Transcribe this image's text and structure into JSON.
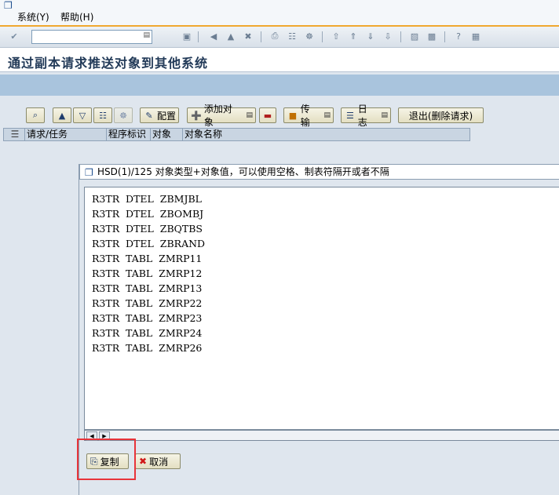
{
  "menu": {
    "system": "系统(Y)",
    "help": "帮助(H)"
  },
  "toolbar": {
    "command_field_value": "",
    "icons": [
      "enter-icon",
      "save-icon",
      "back-icon",
      "exit-icon",
      "cancel-icon",
      "print-icon",
      "find-icon",
      "find-next-icon",
      "first-page-icon",
      "previous-page-icon",
      "next-page-icon",
      "last-page-icon",
      "create-session-icon",
      "shortcut-icon",
      "help-icon",
      "layout-menu-icon"
    ]
  },
  "title": "通过副本请求推送对象到其他系统",
  "app_toolbar": {
    "configure": "配置",
    "add_object": "添加对象",
    "transport": "传输",
    "log": "日志",
    "exit_delete": "退出(删除请求)"
  },
  "table": {
    "columns": [
      "请求/任务",
      "程序标识",
      "对象",
      "对象名称"
    ]
  },
  "dialog": {
    "title": "HSD(1)/125 对象类型+对象值，可以使用空格、制表符隔开或者不隔",
    "lines": [
      "R3TR  DTEL  ZBMJBL",
      "R3TR  DTEL  ZBOMBJ",
      "R3TR  DTEL  ZBQTBS",
      "R3TR  DTEL  ZBRAND",
      "R3TR  TABL  ZMRP11",
      "R3TR  TABL  ZMRP12",
      "R3TR  TABL  ZMRP13",
      "R3TR  TABL  ZMRP22",
      "R3TR  TABL  ZMRP23",
      "R3TR  TABL  ZMRP24",
      "R3TR  TABL  ZMRP26"
    ],
    "copy_button": "复制",
    "cancel_button": "取消"
  },
  "colors": {
    "accent_line": "#f0a830",
    "title_text": "#223a58",
    "highlight_box": "#e8343a",
    "band": "#a9c4dd"
  }
}
